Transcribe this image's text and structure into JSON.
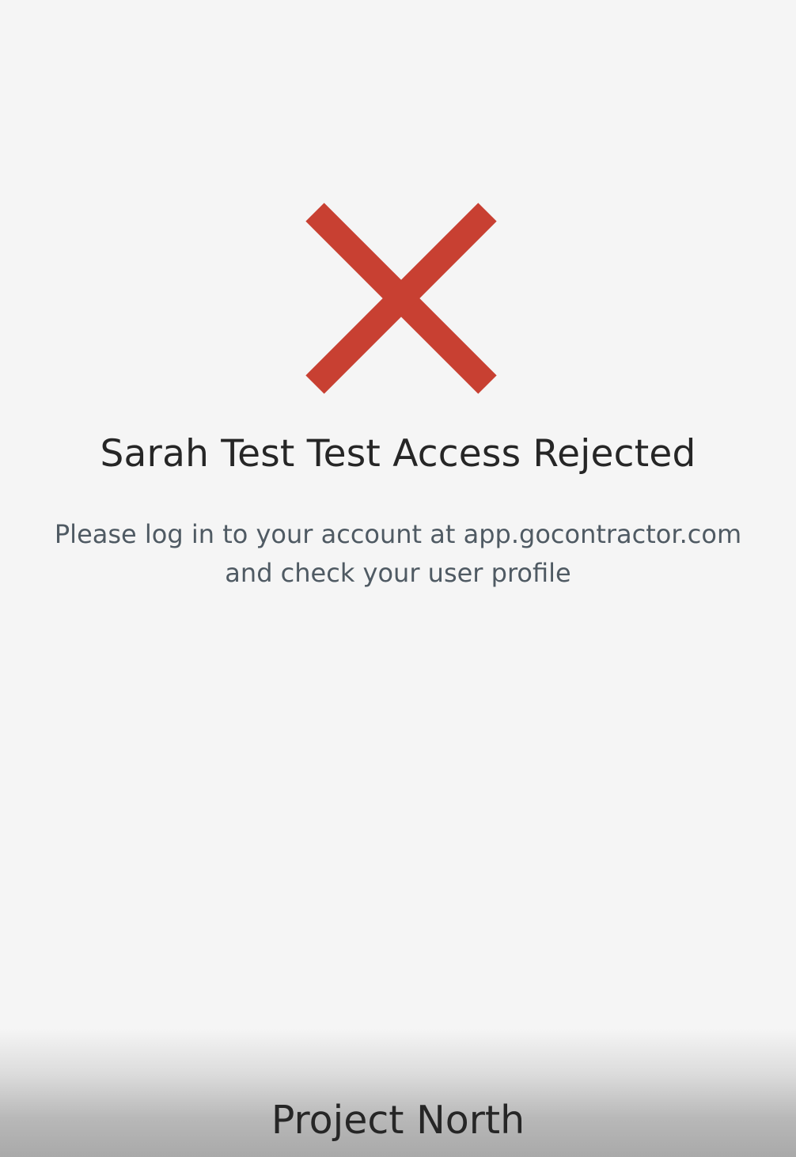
{
  "status": {
    "icon": "close-icon",
    "icon_color": "#c84032",
    "title": "Sarah Test Test Access Rejected",
    "message_line1": "Please log in to your account at app.gocontractor.com",
    "message_line2": "and check your user profile"
  },
  "footer": {
    "project_name": "Project North"
  },
  "colors": {
    "background": "#f5f5f5",
    "title_text": "#262626",
    "message_text": "#4f5a63"
  }
}
